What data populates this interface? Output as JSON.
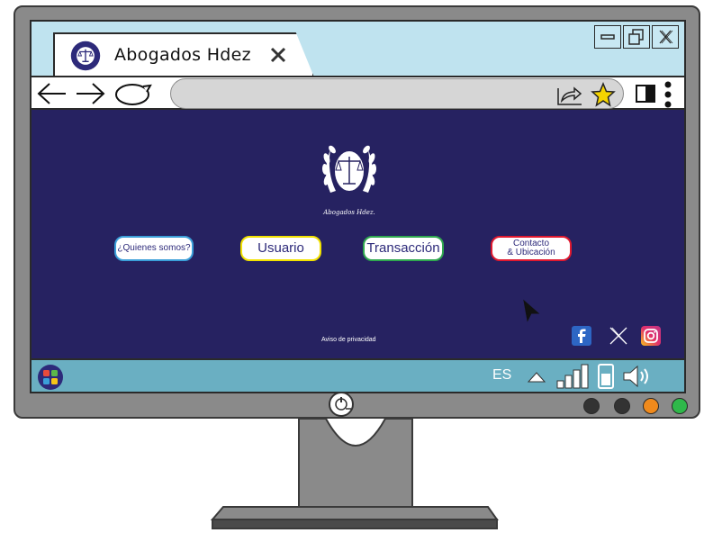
{
  "browser": {
    "tab_title": "Abogados  Hdez",
    "tab_close": "x",
    "window_controls": {
      "minimize": "minimize-icon",
      "restore": "restore-icon",
      "close": "X"
    }
  },
  "page": {
    "logo_caption": "Abogados Hdez.",
    "nav": [
      {
        "label": "¿Quienes somos?",
        "border": "#3b9fd9"
      },
      {
        "label": "Usuario",
        "border": "#f2e200"
      },
      {
        "label": "Transacción",
        "border": "#2fa84f"
      },
      {
        "label_line1": "Contacto",
        "label_line2": "& Ubicación",
        "border": "#e0192f"
      }
    ],
    "privacy": "Aviso de privacidad",
    "social": [
      "facebook-icon",
      "x-icon",
      "instagram-icon"
    ]
  },
  "taskbar": {
    "language": "ES",
    "tray_icons": [
      "chevron-up-icon",
      "signal-icon",
      "battery-icon",
      "volume-icon"
    ]
  },
  "bezel": {
    "dot_colors": [
      "#333333",
      "#333333",
      "#f08a1c",
      "#2fb84a"
    ]
  },
  "colors": {
    "page_bg": "#262261",
    "chrome_bg": "#bfe3ef",
    "taskbar_bg": "#6aafc2",
    "monitor": "#8a8a8a"
  }
}
